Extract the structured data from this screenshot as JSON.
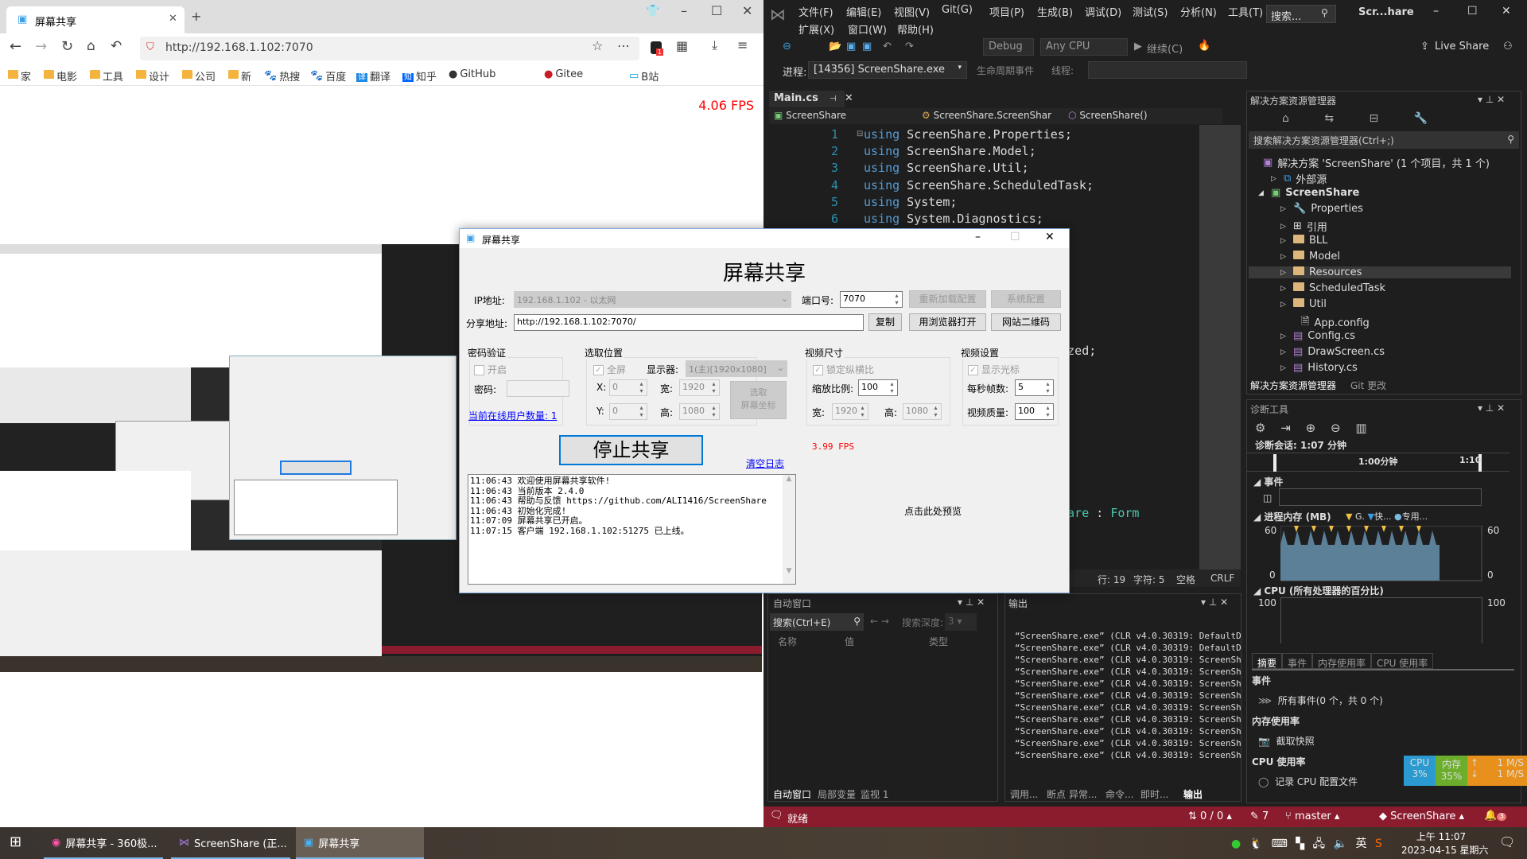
{
  "browser": {
    "tab_title": "屏幕共享",
    "url": "http://192.168.1.102:7070",
    "bookmarks": [
      {
        "label": "家",
        "icon": "folder-icon"
      },
      {
        "label": "电影",
        "icon": "folder-icon"
      },
      {
        "label": "工具",
        "icon": "folder-icon"
      },
      {
        "label": "设计",
        "icon": "folder-icon"
      },
      {
        "label": "公司",
        "icon": "folder-icon"
      },
      {
        "label": "新",
        "icon": "folder-icon"
      },
      {
        "label": "热搜",
        "icon": "baidu-icon"
      },
      {
        "label": "百度",
        "icon": "baidu-icon"
      },
      {
        "label": "翻译",
        "icon": "translate-icon"
      },
      {
        "label": "知乎",
        "icon": "zhihu-icon"
      },
      {
        "label": "GitHub",
        "icon": "github-icon"
      },
      {
        "label": "Gitee",
        "icon": "gitee-icon"
      },
      {
        "label": "B站",
        "icon": "bilibili-icon"
      }
    ],
    "fps": "4.06 FPS",
    "extension_badge": "1"
  },
  "vs": {
    "menu_row1": [
      "文件(F)",
      "编辑(E)",
      "视图(V)",
      "Git(G)",
      "项目(P)",
      "生成(B)",
      "调试(D)",
      "测试(S)",
      "分析(N)",
      "工具(T)"
    ],
    "menu_row2": [
      "扩展(X)",
      "窗口(W)",
      "帮助(H)"
    ],
    "search_placeholder": "搜索...",
    "window_title": "Scr...hare",
    "toolbar": {
      "config": "Debug",
      "platform": "Any CPU",
      "continue": "继续(C)",
      "live_share": "Live Share"
    },
    "process_label": "进程:",
    "process_value": "[14356] ScreenShare.exe",
    "lifecycle": "生命周期事件",
    "thread_label": "线程:",
    "editor": {
      "tab": "Main.cs",
      "nav": [
        "ScreenShare",
        "ScreenShare.ScreenShar",
        "ScreenShare()"
      ],
      "lines": [
        {
          "n": "1",
          "kw": "using",
          "rest": " ScreenShare.Properties;"
        },
        {
          "n": "2",
          "kw": "using",
          "rest": " ScreenShare.Model;"
        },
        {
          "n": "3",
          "kw": "using",
          "rest": " ScreenShare.Util;"
        },
        {
          "n": "4",
          "kw": "using",
          "rest": " ScreenShare.ScheduledTask;"
        },
        {
          "n": "5",
          "kw": "using",
          "rest": " System;"
        },
        {
          "n": "6",
          "kw": "using",
          "rest": " System.Diagnostics;"
        }
      ],
      "fragment1": "cialized;",
      "fragment2_a": "eenShare",
      "fragment2_b": " : ",
      "fragment2_c": "Form",
      "status": {
        "line": "行: 19",
        "char": "字符: 5",
        "spaces": "空格",
        "eol": "CRLF"
      }
    },
    "solution_explorer": {
      "title": "解决方案资源管理器",
      "search": "搜索解决方案资源管理器(Ctrl+;)",
      "items": [
        {
          "label": "解决方案 'ScreenShare' (1 个项目，共 1 个)",
          "icon": "solution-icon"
        },
        {
          "label": "外部源",
          "icon": "external-sources-icon"
        },
        {
          "label": "ScreenShare",
          "icon": "csharp-project-icon"
        },
        {
          "label": "Properties",
          "icon": "wrench-icon"
        },
        {
          "label": "引用",
          "icon": "references-icon"
        },
        {
          "label": "BLL",
          "icon": "folder-icon"
        },
        {
          "label": "Model",
          "icon": "folder-icon"
        },
        {
          "label": "Resources",
          "icon": "folder-icon"
        },
        {
          "label": "ScheduledTask",
          "icon": "folder-icon"
        },
        {
          "label": "Util",
          "icon": "folder-icon"
        },
        {
          "label": "App.config",
          "icon": "config-icon"
        },
        {
          "label": "Config.cs",
          "icon": "form-icon"
        },
        {
          "label": "DrawScreen.cs",
          "icon": "form-icon"
        },
        {
          "label": "History.cs",
          "icon": "form-icon"
        }
      ],
      "tabs": [
        "解决方案资源管理器",
        "Git 更改"
      ]
    },
    "diagnostics": {
      "title": "诊断工具",
      "session": "诊断会话: 1:07 分钟",
      "timeline_ticks": [
        "1:00分钟",
        "1:10"
      ],
      "events_header": "事件",
      "memory_header": "进程内存 (MB)",
      "memory_legend": [
        "G.",
        "快...",
        "专用..."
      ],
      "memory_axis": {
        "max": "60",
        "min": "0"
      },
      "cpu_header": "CPU (所有处理器的百分比)",
      "cpu_axis": {
        "max": "100",
        "min": "0"
      },
      "tabs": [
        "摘要",
        "事件",
        "内存使用率",
        "CPU 使用率"
      ],
      "sections": [
        {
          "header": "事件",
          "item": "所有事件(0 个，共 0 个)"
        },
        {
          "header": "内存使用率",
          "item": "截取快照"
        },
        {
          "header": "CPU 使用率",
          "item": "记录 CPU 配置文件"
        }
      ]
    },
    "perf_widget": {
      "cpu_label": "CPU",
      "cpu": "3%",
      "mem_label": "内存",
      "mem": "35%",
      "up": "1 M/S",
      "down": "1 M/S"
    },
    "autos": {
      "title": "自动窗口",
      "search": "搜索(Ctrl+E)",
      "depth_label": "搜索深度:",
      "depth": "3",
      "columns": [
        "名称",
        "值",
        "类型"
      ],
      "tabs": [
        "自动窗口",
        "局部变量",
        "监视 1"
      ]
    },
    "output": {
      "title": "输出",
      "lines": [
        "“ScreenShare.exe” (CLR v4.0.30319: DefaultD",
        "“ScreenShare.exe” (CLR v4.0.30319: DefaultD",
        "“ScreenShare.exe” (CLR v4.0.30319: ScreenSh",
        "“ScreenShare.exe” (CLR v4.0.30319: ScreenSh",
        "“ScreenShare.exe” (CLR v4.0.30319: ScreenSh",
        "“ScreenShare.exe” (CLR v4.0.30319: ScreenSh",
        "“ScreenShare.exe” (CLR v4.0.30319: ScreenSh",
        "“ScreenShare.exe” (CLR v4.0.30319: ScreenSh",
        "“ScreenShare.exe” (CLR v4.0.30319: ScreenSh",
        "“ScreenShare.exe” (CLR v4.0.30319: ScreenSh",
        "“ScreenShare.exe” (CLR v4.0.30319: ScreenSh"
      ],
      "tabs": [
        "调用...",
        "断点",
        "异常...",
        "命令...",
        "即时...",
        "输出"
      ]
    },
    "status": {
      "ready": "就绪",
      "sync": "0 / 0",
      "edits": "7",
      "branch": "master",
      "repo": "ScreenShare",
      "notifications": "3"
    }
  },
  "app": {
    "window_title": "屏幕共享",
    "heading": "屏幕共享",
    "ip_label": "IP地址:",
    "ip_value": "192.168.1.102 - 以太网",
    "port_label": "端口号:",
    "port_value": "7070",
    "reload_button": "重新加载配置",
    "system_button": "系统配置",
    "share_label": "分享地址:",
    "share_value": "http://192.168.1.102:7070/",
    "copy_button": "复制",
    "open_browser_button": "用浏览器打开",
    "qr_button": "网站二维码",
    "password_group": {
      "title": "密码验证",
      "enable": "开启",
      "password_label": "密码:",
      "password_value": ""
    },
    "region_group": {
      "title": "选取位置",
      "fullscreen": "全屏",
      "monitor_label": "显示器:",
      "monitor_value": "1(主)[1920x1080]",
      "x_label": "X:",
      "x": "0",
      "y_label": "Y:",
      "y": "0",
      "w_label": "宽:",
      "w": "1920",
      "h_label": "高:",
      "h": "1080",
      "pick_button": "选取\n屏幕坐标"
    },
    "size_group": {
      "title": "视频尺寸",
      "lock_ratio": "锁定纵横比",
      "scale_label": "缩放比例:",
      "scale": "100",
      "w_label": "宽:",
      "w": "1920",
      "h_label": "高:",
      "h": "1080"
    },
    "video_group": {
      "title": "视频设置",
      "show_cursor": "显示光标",
      "fps_label": "每秒帧数:",
      "fps": "5",
      "quality_label": "视频质量:",
      "quality": "100"
    },
    "online_users": "当前在线用户数量: 1",
    "stop_button": "停止共享",
    "fps": "3.99 FPS",
    "clear_log": "清空日志",
    "log": [
      "11:06:43 欢迎使用屏幕共享软件!",
      "11:06:43 当前版本 2.4.0",
      "11:06:43 帮助与反馈 https://github.com/ALI1416/ScreenShare",
      "11:06:43 初始化完成!",
      "11:07:09 屏幕共享已开启。",
      "11:07:15 客户端 192.168.1.102:51275 已上线。"
    ],
    "preview_hint": "点击此处预览"
  },
  "taskbar": {
    "items": [
      "屏幕共享 - 360极...",
      "ScreenShare (正...",
      "屏幕共享"
    ],
    "tray_lang": "英",
    "time": "上午 11:07",
    "date": "2023-04-15 星期六"
  },
  "colors": {
    "vs_status": "#8a1c2e",
    "fps_red": "#ff0000",
    "link_blue": "#0000ff",
    "vs_keyword": "#569cd6",
    "memory_fill": "#5b8097"
  }
}
